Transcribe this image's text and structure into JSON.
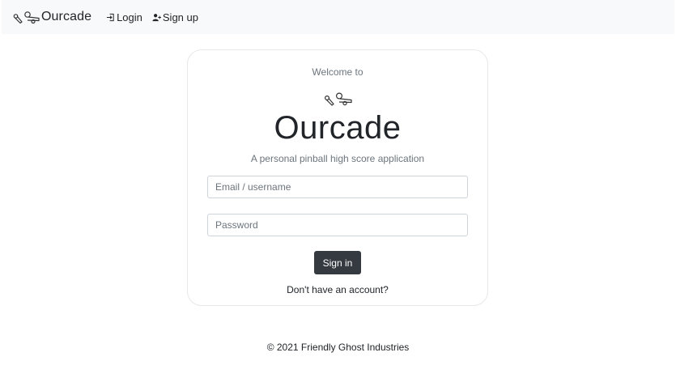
{
  "navbar": {
    "brand_name": "Ourcade",
    "brand_icon": "pinball-flippers-icon",
    "links": [
      {
        "label": "Login",
        "icon": "login-icon"
      },
      {
        "label": "Sign up",
        "icon": "user-plus-icon"
      }
    ]
  },
  "card": {
    "welcome": "Welcome to",
    "logo_icon": "pinball-flippers-icon",
    "title": "Ourcade",
    "tagline": "A personal pinball high score application",
    "email_placeholder": "Email / username",
    "email_value": "",
    "password_placeholder": "Password",
    "password_value": "",
    "signin_label": "Sign in",
    "account_prompt": "Don't have an account?"
  },
  "footer": {
    "text": "© 2021 Friendly Ghost Industries"
  },
  "colors": {
    "navbar_bg": "#f8f9fa",
    "button_bg": "#343a40",
    "muted_text": "#6c757d"
  }
}
